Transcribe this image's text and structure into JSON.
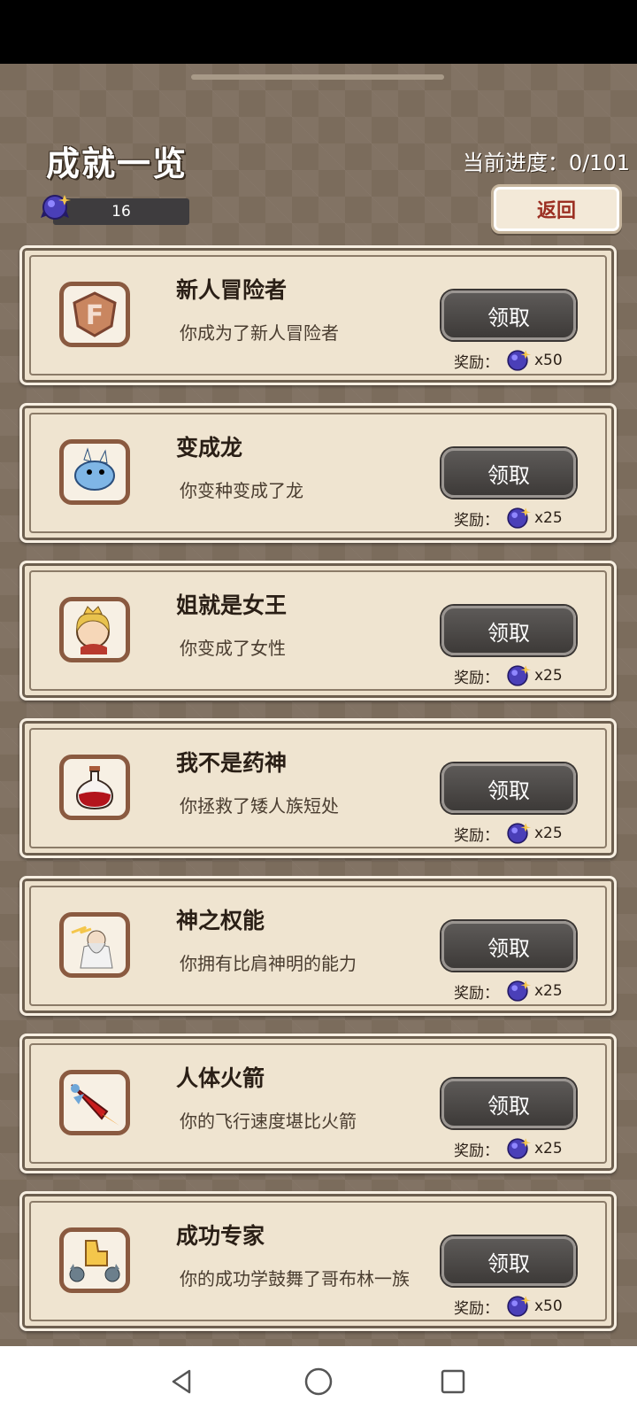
{
  "header": {
    "title": "成就一览",
    "progress_label": "当前进度：0/101",
    "gem_count": "16",
    "back_label": "返回"
  },
  "achievements": [
    {
      "title": "新人冒险者",
      "desc": "你成为了新人冒险者",
      "button": "领取",
      "reward_label": "奖励：",
      "reward": "x50",
      "icon": "bronze-f-rank-badge-icon"
    },
    {
      "title": "变成龙",
      "desc": "你变种变成了龙",
      "button": "领取",
      "reward_label": "奖励：",
      "reward": "x25",
      "icon": "blue-dragon-icon"
    },
    {
      "title": "姐就是女王",
      "desc": "你变成了女性",
      "button": "领取",
      "reward_label": "奖励：",
      "reward": "x25",
      "icon": "queen-icon"
    },
    {
      "title": "我不是药神",
      "desc": "你拯救了矮人族短处",
      "button": "领取",
      "reward_label": "奖励：",
      "reward": "x25",
      "icon": "red-potion-icon"
    },
    {
      "title": "神之权能",
      "desc": "你拥有比肩神明的能力",
      "button": "领取",
      "reward_label": "奖励：",
      "reward": "x25",
      "icon": "zeus-icon"
    },
    {
      "title": "人体火箭",
      "desc": "你的飞行速度堪比火箭",
      "button": "领取",
      "reward_label": "奖励：",
      "reward": "x25",
      "icon": "rocket-icon"
    },
    {
      "title": "成功专家",
      "desc": "你的成功学鼓舞了哥布林一族",
      "button": "领取",
      "reward_label": "奖励：",
      "reward": "x50",
      "icon": "goblin-thumbs-up-icon"
    }
  ],
  "colors": {
    "background": "#7b6c5c",
    "card": "#ede1cc",
    "button": "#4a4745",
    "back_text": "#9b2f22"
  }
}
